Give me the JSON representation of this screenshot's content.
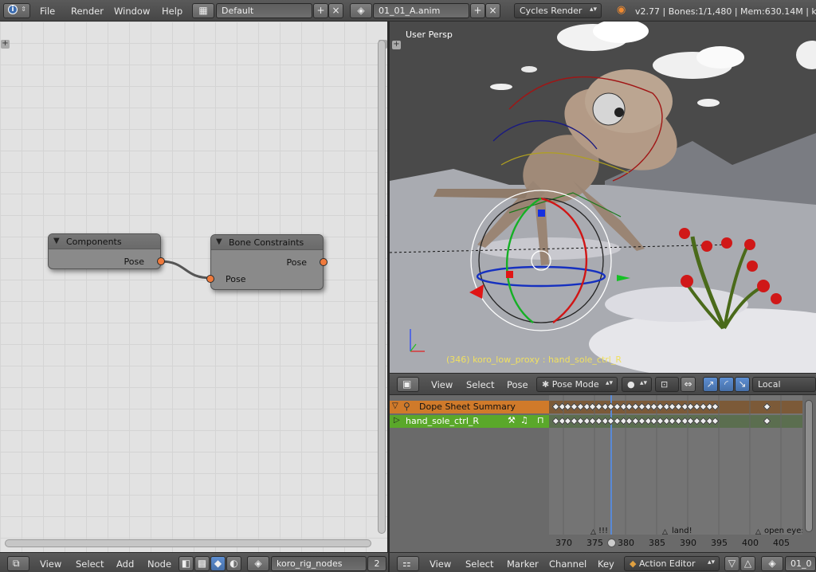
{
  "top": {
    "menus": [
      "File",
      "Render",
      "Window",
      "Help"
    ],
    "screen_layout": "Default",
    "scene_name": "01_01_A.anim",
    "render_engine": "Cycles Render",
    "stats": "v2.77 | Bones:1/1,480 | Mem:630.14M | ko"
  },
  "node_editor": {
    "nodes": [
      {
        "title": "Components",
        "outputs": [
          "Pose"
        ],
        "inputs": []
      },
      {
        "title": "Bone Constraints",
        "outputs": [
          "Pose"
        ],
        "inputs": [
          "Pose"
        ]
      }
    ],
    "footer": {
      "menus": [
        "View",
        "Select",
        "Add",
        "Node"
      ],
      "tree_name": "koro_rig_nodes",
      "users": "2"
    }
  },
  "viewport": {
    "label": "User Persp",
    "status": "(346) koro_low_proxy : hand_sole_ctrl_R",
    "toolbar": {
      "menus": [
        "View",
        "Select",
        "Pose"
      ],
      "mode": "Pose Mode",
      "orientation": "Local"
    }
  },
  "dopesheet": {
    "channels": [
      {
        "name": "Dope Sheet Summary",
        "color": "#d07a2a"
      },
      {
        "name": "hand_sole_ctrl_R",
        "color": "#5aa82a"
      }
    ],
    "frames": [
      "370",
      "375",
      "380",
      "385",
      "390",
      "395",
      "400",
      "405"
    ],
    "current_frame": 378,
    "markers": [
      "!!!",
      "land!",
      "open eye:"
    ],
    "footer": {
      "menus": [
        "View",
        "Select",
        "Marker",
        "Channel",
        "Key"
      ],
      "mode": "Action Editor",
      "action_name": "01_0"
    }
  },
  "colors": {
    "accent_orange": "#f07a3c",
    "summary_row": "#d07a2a",
    "channel_row": "#5aa82a"
  }
}
